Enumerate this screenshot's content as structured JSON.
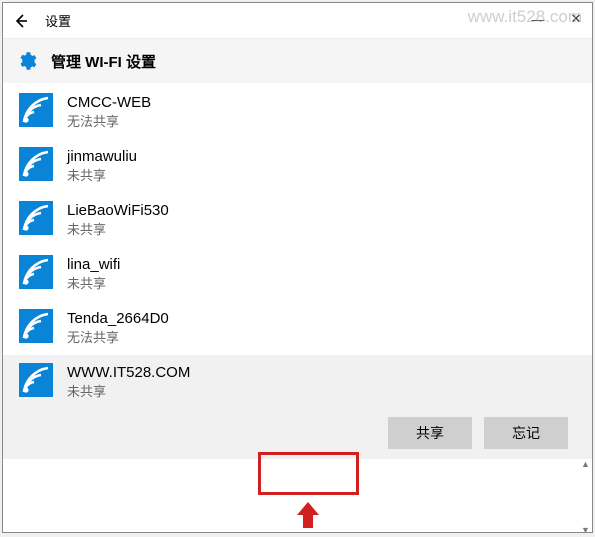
{
  "titlebar": {
    "back_label": "返回",
    "title": "设置",
    "minimize": "—",
    "close": "✕"
  },
  "header": {
    "title": "管理 WI-FI 设置"
  },
  "status": {
    "cannot_share": "无法共享",
    "not_shared": "未共享"
  },
  "watermark": "www.it528.com",
  "networks": [
    {
      "name": "CMCC-WEB",
      "status_key": "cannot_share",
      "selected": false
    },
    {
      "name": "jinmawuliu",
      "status_key": "not_shared",
      "selected": false
    },
    {
      "name": "LieBaoWiFi530",
      "status_key": "not_shared",
      "selected": false
    },
    {
      "name": "lina_wifi",
      "status_key": "not_shared",
      "selected": false
    },
    {
      "name": "Tenda_2664D0",
      "status_key": "cannot_share",
      "selected": false
    },
    {
      "name": "WWW.IT528.COM",
      "status_key": "not_shared",
      "selected": true
    }
  ],
  "actions": {
    "share": "共享",
    "forget": "忘记"
  }
}
